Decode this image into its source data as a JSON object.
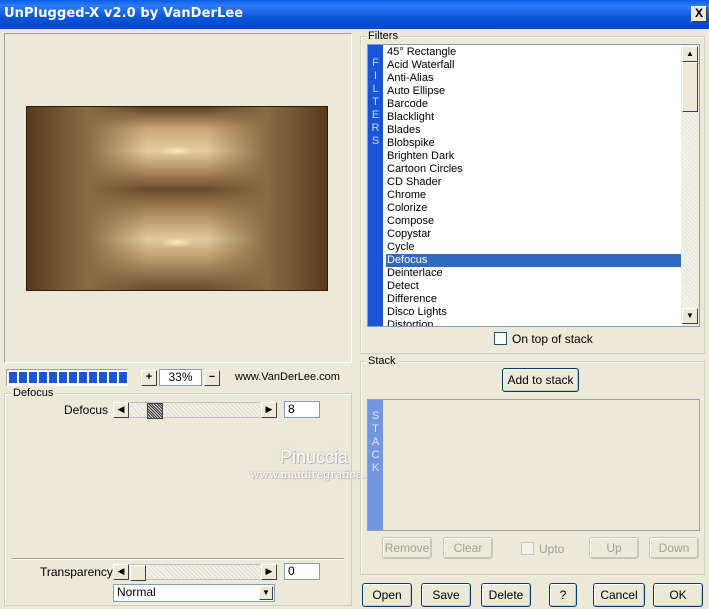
{
  "window": {
    "title": "UnPlugged-X v2.0 by VanDerLee",
    "close_label": "X"
  },
  "filters": {
    "group_label": "Filters",
    "vtab_letters": [
      "F",
      "I",
      "L",
      "T",
      "E",
      "R",
      "S"
    ],
    "items": [
      "45° Rectangle",
      "Acid Waterfall",
      "Anti-Alias",
      "Auto Ellipse",
      "Barcode",
      "Blacklight",
      "Blades",
      "Blobspike",
      "Brighten Dark",
      "Cartoon Circles",
      "CD Shader",
      "Chrome",
      "Colorize",
      "Compose",
      "Copystar",
      "Cycle",
      "Defocus",
      "Deinterlace",
      "Detect",
      "Difference",
      "Disco Lights",
      "Distortion"
    ],
    "selected": "Defocus",
    "on_top_of_stack_label": "On top of stack"
  },
  "zoom": {
    "minus_label": "+",
    "value": "33%",
    "plus_label": "−",
    "website": "www.VanDerLee.com"
  },
  "defocus": {
    "group_label": "Defocus",
    "param_label": "Defocus",
    "param_value": "8",
    "transparency_label": "Transparency",
    "transparency_value": "0",
    "blend_mode": "Normal"
  },
  "stack": {
    "group_label": "Stack",
    "add_label": "Add to stack",
    "vtab_letters": [
      "S",
      "T",
      "A",
      "C",
      "K"
    ],
    "remove_label": "Remove",
    "clear_label": "Clear",
    "upto_label": "Upto",
    "up_label": "Up",
    "down_label": "Down"
  },
  "footer": {
    "open_label": "Open",
    "save_label": "Save",
    "delete_label": "Delete",
    "help_label": "?",
    "cancel_label": "Cancel",
    "ok_label": "OK"
  },
  "watermark": {
    "name": "Pinuccia",
    "url": "www.maidiregrafica.eu"
  },
  "colors": {
    "titlebar": "#0a5ee8",
    "selection": "#316ac5",
    "window_bg": "#ece9d8",
    "progress": "#1a55d6"
  }
}
